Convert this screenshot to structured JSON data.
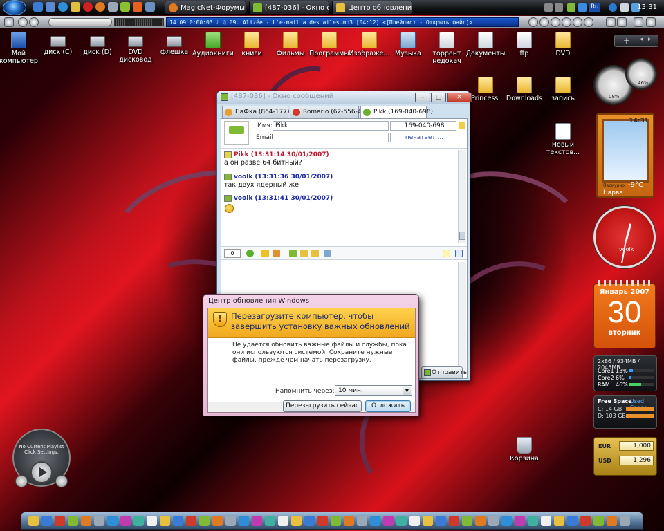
{
  "taskbar": {
    "tasks": [
      {
        "label": "MagicNet-Форумы ...",
        "active": false
      },
      {
        "label": "[487-036] - Окно со...",
        "active": false
      },
      {
        "label": "Центр обновления ...",
        "active": true
      }
    ],
    "language": "Ru",
    "clock": "13:31"
  },
  "mediabar": {
    "track_display": "14  09  0:00:03  ♪  ♫  09. Alizée - L'e-mail a des ailes.mp3  [04:12]   <[Плейлист - Открыть файл]>"
  },
  "desktop_icons": [
    {
      "label": "Мой компьютер",
      "type": "computer"
    },
    {
      "label": "диск (C)",
      "type": "drive"
    },
    {
      "label": "диск (D)",
      "type": "drive"
    },
    {
      "label": "DVD дисковод",
      "type": "dvd"
    },
    {
      "label": "флешка",
      "type": "usb"
    },
    {
      "label": "Аудиокниги",
      "type": "folder-green"
    },
    {
      "label": "книги",
      "type": "folder"
    },
    {
      "label": "Фильмы",
      "type": "folder"
    },
    {
      "label": "Программы",
      "type": "folder"
    },
    {
      "label": "Изображе...",
      "type": "folder"
    },
    {
      "label": "Музыка",
      "type": "folder-music"
    },
    {
      "label": "торрент недокач",
      "type": "shortcut"
    },
    {
      "label": "Документы",
      "type": "shortcut"
    },
    {
      "label": "ftp",
      "type": "shortcut"
    },
    {
      "label": "DVD",
      "type": "folder"
    },
    {
      "label": "Princessi",
      "type": "folder"
    },
    {
      "label": "Downloads",
      "type": "shortcut"
    },
    {
      "label": "запись",
      "type": "folder"
    },
    {
      "label": "Новый текстов...",
      "type": "textfile"
    },
    {
      "label": "Корзина",
      "type": "recycle-bin"
    }
  ],
  "gadgets": {
    "meter_cpu_label": "08%",
    "meter_mem_label": "46%",
    "weather": {
      "time": "14:31",
      "city": "Нарва",
      "condition": "Пасмурно",
      "temp": "-9°C"
    },
    "clock_label": "voolk",
    "calendar": {
      "month_year": "Январь 2007",
      "day": "30",
      "weekday": "вторник"
    },
    "sysinfo": {
      "header": "2x86 / 934MB / 2045MB",
      "rows": [
        {
          "label": "Core1",
          "value": "13%"
        },
        {
          "label": "Core2",
          "value": "6%"
        },
        {
          "label": "RAM",
          "value": "46%"
        }
      ]
    },
    "disk": {
      "title_free": "Free Space",
      "title_used": "Used Space",
      "rows": [
        {
          "label": "C: 14 GB"
        },
        {
          "label": "D: 103 GB"
        }
      ]
    },
    "currency": {
      "rows": [
        {
          "code": "EUR",
          "value": "1,000"
        },
        {
          "code": "USD",
          "value": "1,296"
        }
      ]
    },
    "media_player": {
      "text": "No Current Playlist Click Settings."
    }
  },
  "message_window": {
    "title": "[487-036] - Окно сообщений",
    "tabs": [
      {
        "label": "ПаФка (864-177)"
      },
      {
        "label": "Romario (62-556-496)"
      },
      {
        "label": "Pikk (169-040-698)"
      }
    ],
    "name_label": "Имя:",
    "name_value": "Pikk",
    "uin_value": "169-040-698",
    "email_label": "Email:",
    "email_value": "",
    "typing_status": "печатает ...",
    "messages": [
      {
        "header": "Pikk (13:31:14 30/01/2007)",
        "text": "а он разве 64 битный?",
        "color": "#c0182a"
      },
      {
        "header": "voolk (13:31:36 30/01/2007)",
        "text": "так двух ядерный же",
        "color": "#1a2aa8"
      },
      {
        "header": "voolk (13:31:41 30/01/2007)",
        "text": "",
        "color": "#1a2aa8"
      }
    ],
    "char_counter": "0",
    "send_label": "Отправить"
  },
  "update_dialog": {
    "title": "Центр обновления Windows",
    "headline": "Перезагрузите компьютер, чтобы завершить установку важных обновлений",
    "message": "Не удается обновить важные файлы и службы, пока они используются системой. Сохраните нужные файлы, прежде чем начать перезагрузку.",
    "remind_label": "Напомнить через:",
    "remind_value": "10 мин.",
    "restart_label": "Перезагрузить сейчас",
    "postpone_label": "Отложить"
  }
}
